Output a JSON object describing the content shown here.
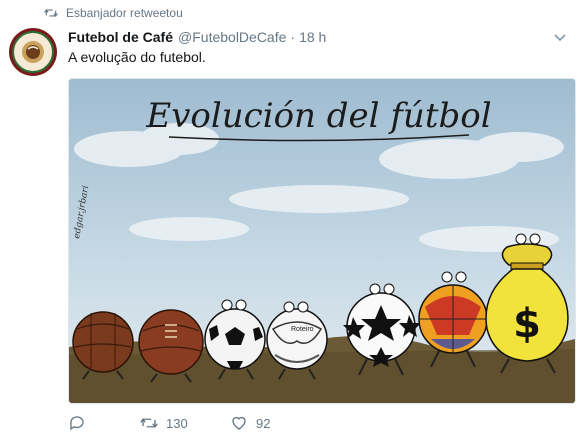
{
  "retweet_context": {
    "text": "Esbanjador retweetou"
  },
  "tweet": {
    "author_name": "Futebol de Café",
    "handle": "@FutebolDeCafe",
    "separator": "·",
    "time": "18 h",
    "text": "A evolução do futebol."
  },
  "media": {
    "title": "Evolución del fútbol",
    "signature": "edgar.jrbari",
    "ball_label_roteiro": "Roteiro"
  },
  "actions": {
    "reply_count": "",
    "retweet_count": "130",
    "like_count": "92"
  },
  "colors": {
    "secondary_text": "#657786",
    "primary_text": "#14171a",
    "retweet_accent": "#657786"
  },
  "icons": {
    "retweet_context": "retweet-icon",
    "caret": "chevron-down-icon",
    "reply": "reply-icon",
    "retweet": "retweet-icon",
    "like": "heart-icon"
  }
}
